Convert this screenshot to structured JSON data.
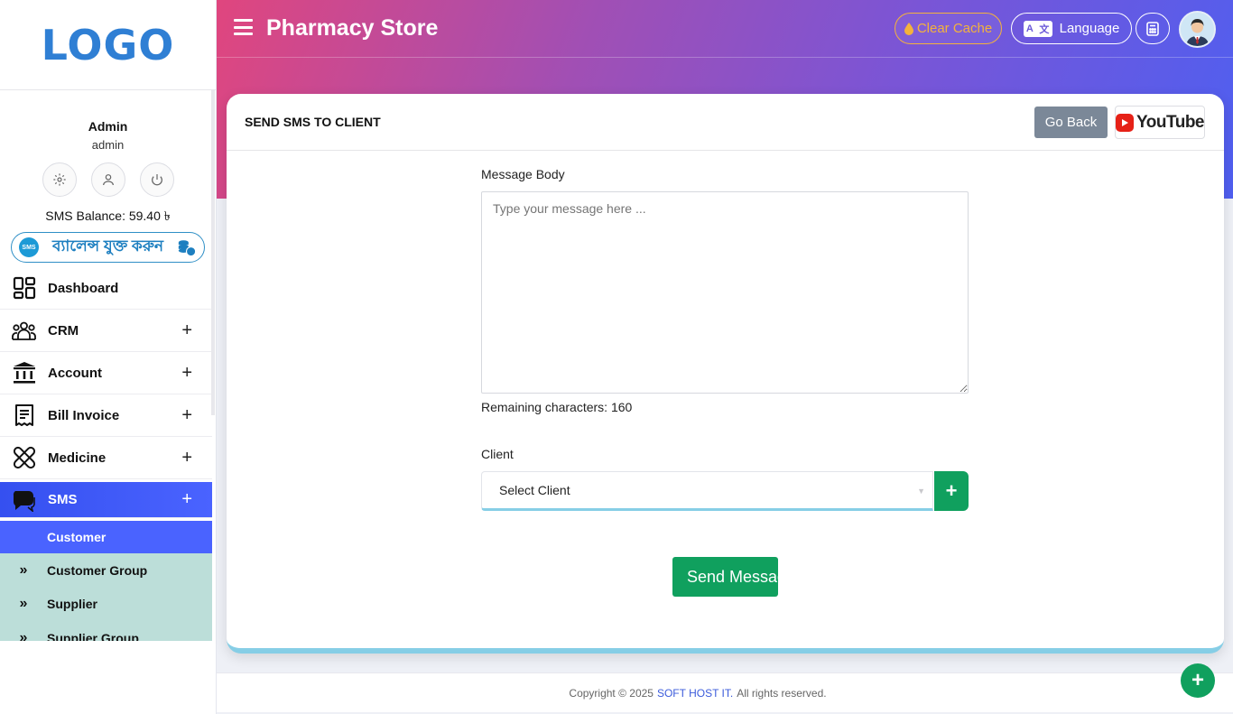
{
  "sidebar": {
    "logo": "LOGO",
    "user_name": "Admin",
    "user_role": "admin",
    "sms_balance": "SMS Balance: 59.40 ৳",
    "add_balance_label": "ব্যালেন্স যুক্ত করুন",
    "sms_badge": "SMS",
    "menu": [
      {
        "label": "Dashboard",
        "icon": "dashboard-icon",
        "expandable": false
      },
      {
        "label": "CRM",
        "icon": "users-icon",
        "expandable": true
      },
      {
        "label": "Account",
        "icon": "bank-icon",
        "expandable": true
      },
      {
        "label": "Bill Invoice",
        "icon": "invoice-icon",
        "expandable": true
      },
      {
        "label": "Medicine",
        "icon": "pill-icon",
        "expandable": true
      },
      {
        "label": "SMS",
        "icon": "chat-icon",
        "expandable": true,
        "active": true
      }
    ],
    "plus": "+",
    "submenu": [
      {
        "label": "Customer",
        "active": true
      },
      {
        "label": "Customer Group"
      },
      {
        "label": "Supplier"
      },
      {
        "label": "Supplier Group"
      }
    ],
    "raquo": "»"
  },
  "header": {
    "title": "Pharmacy Store",
    "clear_cache": "Clear Cache",
    "language": "Language",
    "lang_icon_a": "A",
    "lang_icon_b": "文"
  },
  "card": {
    "title": "SEND SMS TO CLIENT",
    "go_back": "Go Back",
    "youtube": "YouTube",
    "message_label": "Message Body",
    "message_placeholder": "Type your message here ...",
    "remaining": "Remaining characters: 160",
    "client_label": "Client",
    "client_selected": "Select Client",
    "add_client": "+",
    "send_button": "Send Message"
  },
  "footer": {
    "prefix": "Copyright © 2025",
    "brand": "SOFT HOST IT.",
    "suffix": "All rights reserved."
  },
  "fab": "+",
  "colors": {
    "accent": "#4a63ff",
    "success": "#10a05e",
    "logo": "#2f7fd4",
    "warning": "#f4b23c"
  }
}
